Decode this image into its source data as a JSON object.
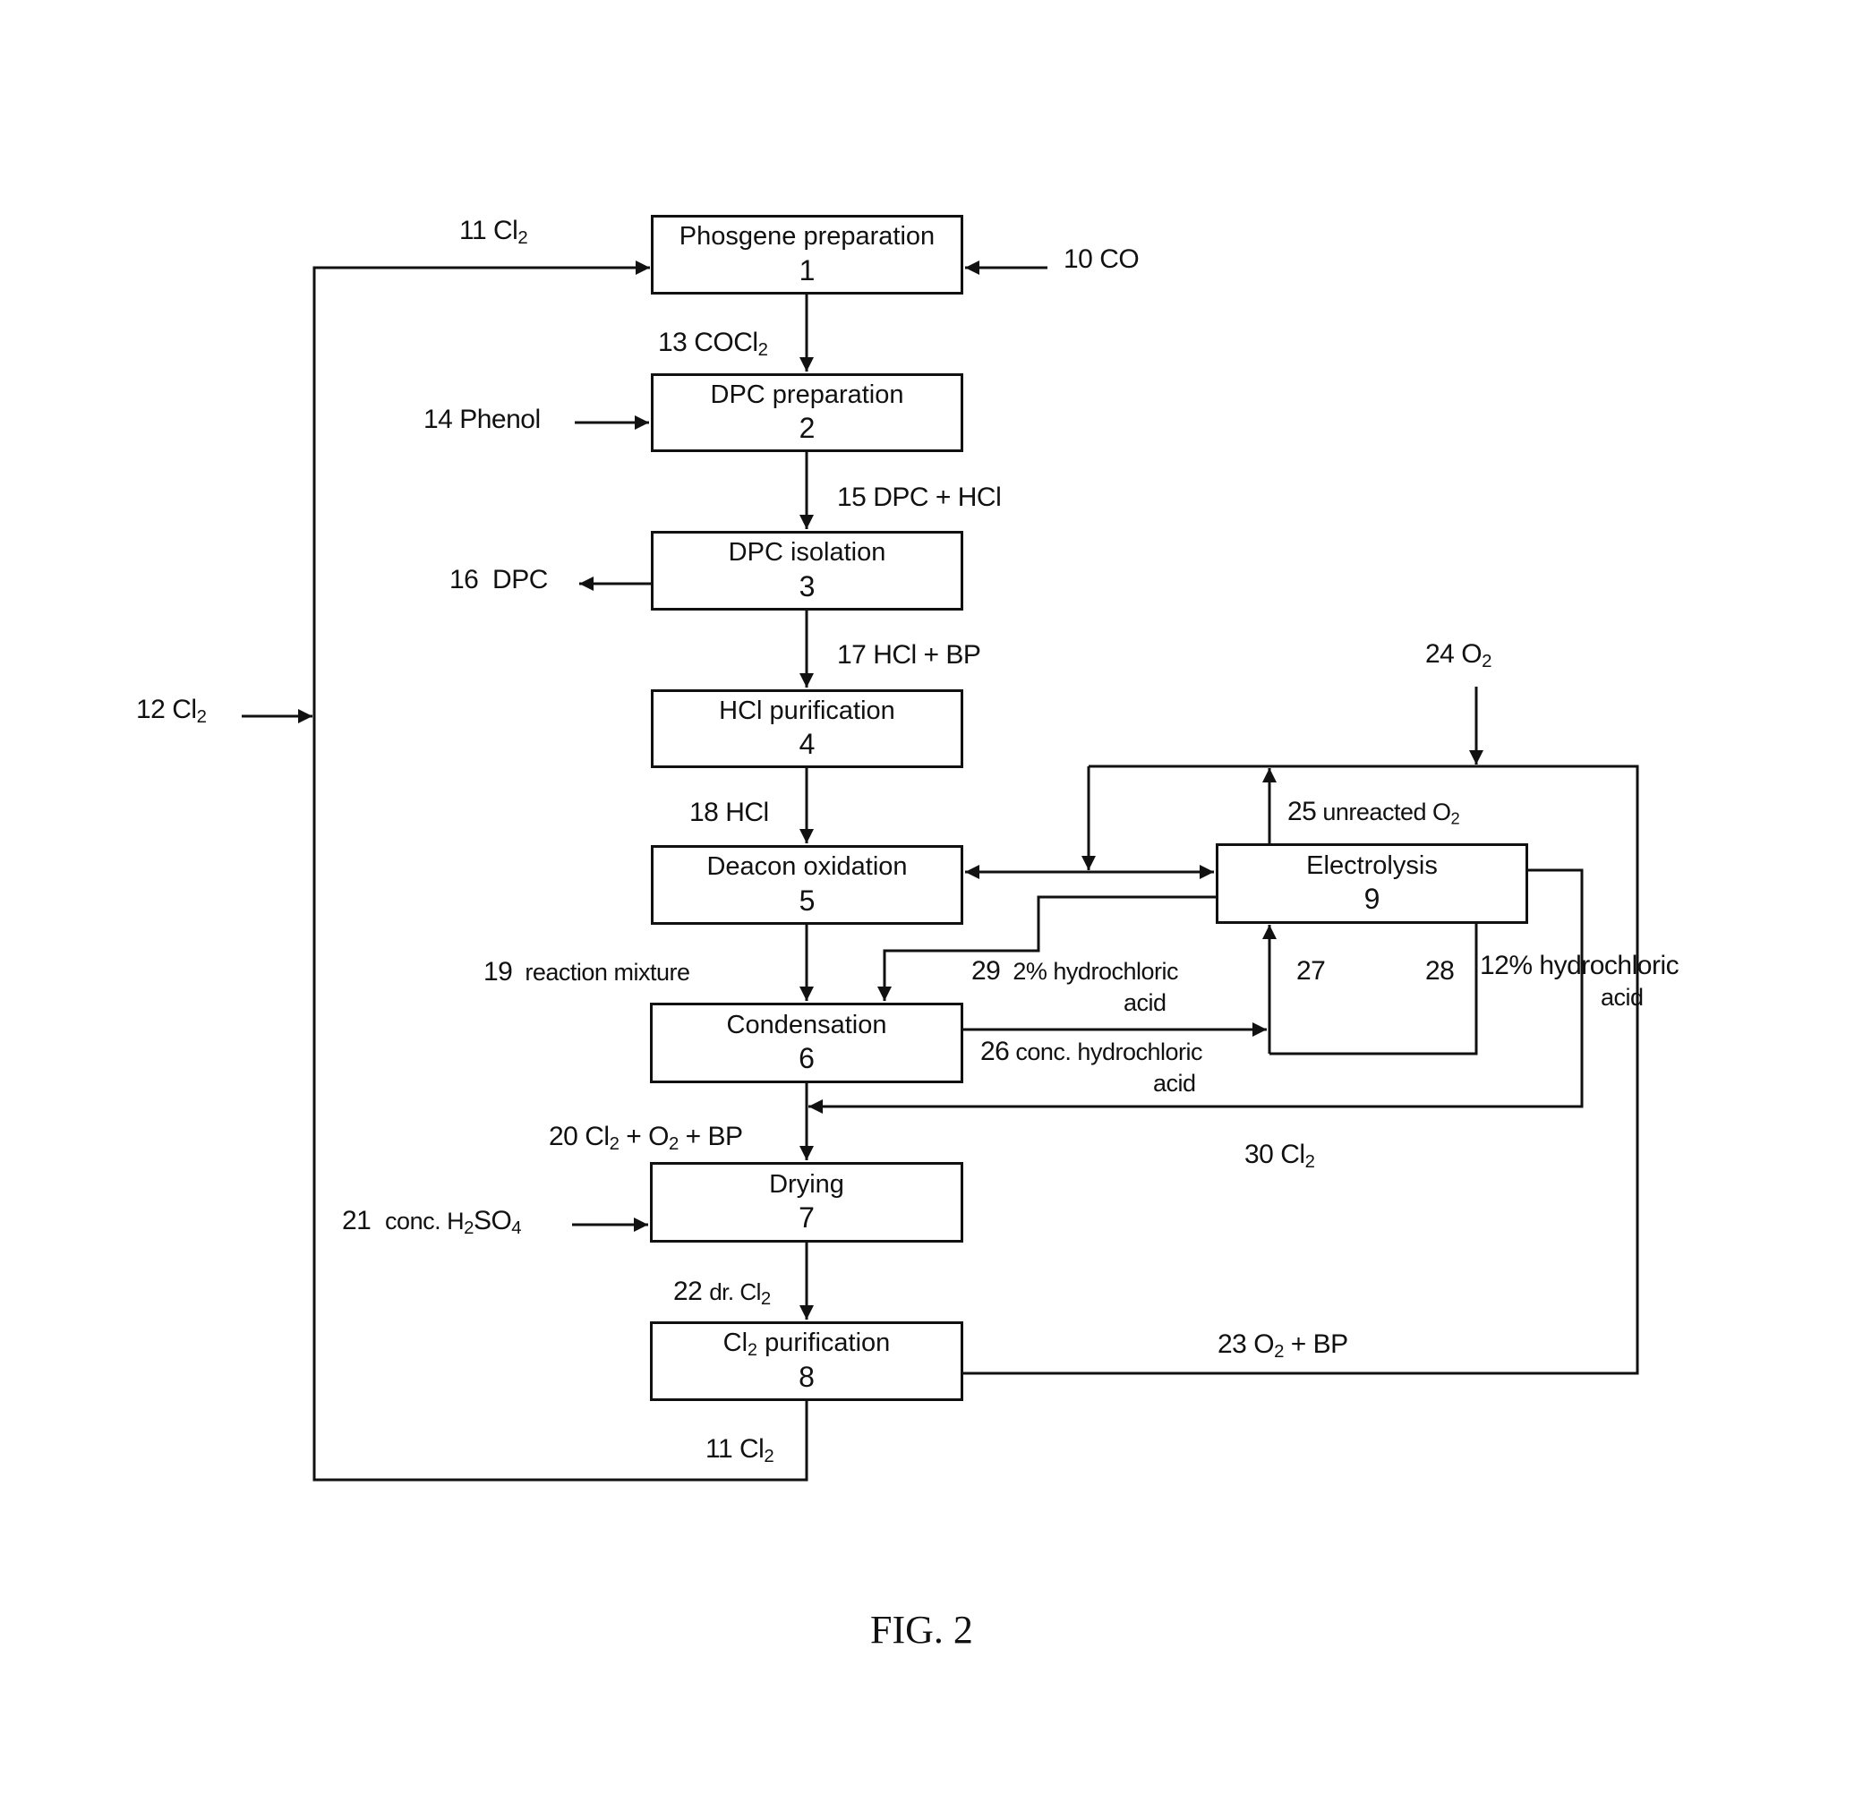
{
  "figure": {
    "caption": "FIG. 2"
  },
  "units": [
    {
      "id": "1",
      "name": "Phosgene preparation",
      "number": "1"
    },
    {
      "id": "2",
      "name": "DPC preparation",
      "number": "2"
    },
    {
      "id": "3",
      "name": "DPC isolation",
      "number": "3"
    },
    {
      "id": "4",
      "name": "HCl purification",
      "number": "4"
    },
    {
      "id": "5",
      "name": "Deacon oxidation",
      "number": "5"
    },
    {
      "id": "6",
      "name": "Condensation",
      "number": "6"
    },
    {
      "id": "7",
      "name": "Drying",
      "number": "7"
    },
    {
      "id": "8",
      "name_pre": "Cl",
      "name_sub": "2",
      "name_post": " purification",
      "number": "8"
    },
    {
      "id": "9",
      "name": "Electrolysis",
      "number": "9"
    }
  ],
  "streams": {
    "s10": {
      "num": "10",
      "text": "CO"
    },
    "s11_top": {
      "num": "11",
      "text": "Cl",
      "sub": "2"
    },
    "s11_bottom": {
      "num": "11",
      "text": "Cl",
      "sub": "2"
    },
    "s12": {
      "num": "12",
      "text": "Cl",
      "sub": "2"
    },
    "s13": {
      "num": "13",
      "text": "COCl",
      "sub": "2"
    },
    "s14": {
      "num": "14",
      "text": "Phenol"
    },
    "s15": {
      "num": "15",
      "text": "DPC + HCl"
    },
    "s16": {
      "num": "16",
      "text": "DPC"
    },
    "s17": {
      "num": "17",
      "text": "HCl + BP"
    },
    "s18": {
      "num": "18",
      "text": "HCl"
    },
    "s19": {
      "num": "19",
      "text": "reaction mixture"
    },
    "s20": {
      "num": "20",
      "a": "Cl",
      "a_sub": "2",
      "b": " + O",
      "b_sub": "2",
      "c": " + BP"
    },
    "s21": {
      "num": "21",
      "a": "conc. H",
      "a_sub": "2",
      "b": "SO",
      "b_sub": "4"
    },
    "s22": {
      "num": "22",
      "text": "dr. Cl",
      "sub": "2"
    },
    "s23": {
      "num": "23",
      "a": "O",
      "a_sub": "2",
      "b": " + BP"
    },
    "s24": {
      "num": "24",
      "text": "O",
      "sub": "2"
    },
    "s25": {
      "num": "25",
      "text": "unreacted O",
      "sub": "2"
    },
    "s26": {
      "num": "26",
      "line1": "conc. hydrochloric",
      "line2": "acid"
    },
    "s27": {
      "num": "27"
    },
    "s28": {
      "num": "28"
    },
    "s29": {
      "num": "29",
      "line1": "2% hydrochloric",
      "line2": "acid"
    },
    "s12pct": {
      "line1": "12% hydrochloric",
      "line2": "acid"
    },
    "s30": {
      "num": "30",
      "text": "Cl",
      "sub": "2"
    }
  },
  "colors": {
    "line": "#111111",
    "background": "#ffffff"
  }
}
